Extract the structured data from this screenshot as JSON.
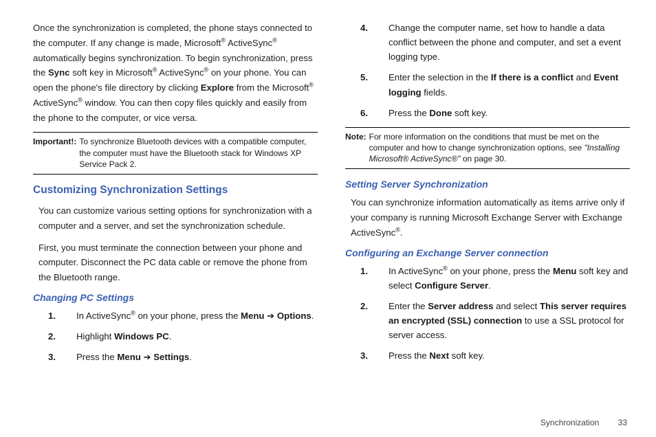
{
  "left": {
    "intro_html": "Once the synchronization is completed, the phone stays connected to the computer. If any change is made, Microsoft<sup>®</sup> ActiveSync<sup>®</sup> automatically begins synchronization. To begin synchronization, press the <span class='bold'>Sync</span> soft key in Microsoft<sup>®</sup> ActiveSync<sup>®</sup> on your phone. You can open the phone's file directory by clicking <span class='bold'>Explore</span> from the Microsoft<sup>®</sup> ActiveSync<sup>®</sup> window. You can then copy files quickly and easily from the phone to the computer, or vice versa.",
    "important_label": "Important!:",
    "important_text": "To synchronize Bluetooth devices with a compatible computer, the computer must have the Bluetooth stack for Windows XP Service Pack 2.",
    "h2": "Customizing Synchronization Settings",
    "p1": "You can customize various setting options for synchronization with a computer and a server, and set the synchronization schedule.",
    "p2": "First, you must terminate the connection between your phone and computer. Disconnect the PC data cable or remove the phone from the Bluetooth range.",
    "h3": "Changing PC Settings",
    "steps": [
      "In ActiveSync<sup>®</sup> on your phone, press the <span class='bold'>Menu</span> <span class='arrow'>➔</span> <span class='bold'>Options</span>.",
      "Highlight <span class='bold'>Windows PC</span>.",
      "Press the <span class='bold'>Menu</span> <span class='arrow'>➔</span> <span class='bold'>Settings</span>."
    ]
  },
  "right": {
    "cont_steps_start": 4,
    "cont_steps": [
      "Change the computer name, set how to handle a data conflict between the phone and computer, and set a event logging type.",
      "Enter the selection in the <span class='bold'>If there is a conflict</span> and <span class='bold'>Event logging</span> fields.",
      "Press the <span class='bold'>Done</span> soft key."
    ],
    "note_label": "Note:",
    "note_text_html": "For more information on the conditions that must be met on the computer and how to change synchronization options, see <span class='italic'>\"Installing Microsoft® ActiveSync®\"</span> on page 30.",
    "h3a": "Setting Server Synchronization",
    "p_server": "You can synchronize information automatically as items arrive only if your company is running Microsoft Exchange Server with Exchange ActiveSync<sup>®</sup>.",
    "h3b": "Configuring an Exchange Server connection",
    "ex_steps": [
      "In ActiveSync<sup>®</sup> on your phone, press the <span class='bold'>Menu</span> soft key and select <span class='bold'>Configure Server</span>.",
      "Enter the <span class='bold'>Server address</span> and select <span class='bold'>This server requires an encrypted (SSL) connection</span> to use a SSL protocol for server access.",
      "Press the <span class='bold'>Next</span> soft key."
    ]
  },
  "footer": {
    "section": "Synchronization",
    "page": "33"
  }
}
